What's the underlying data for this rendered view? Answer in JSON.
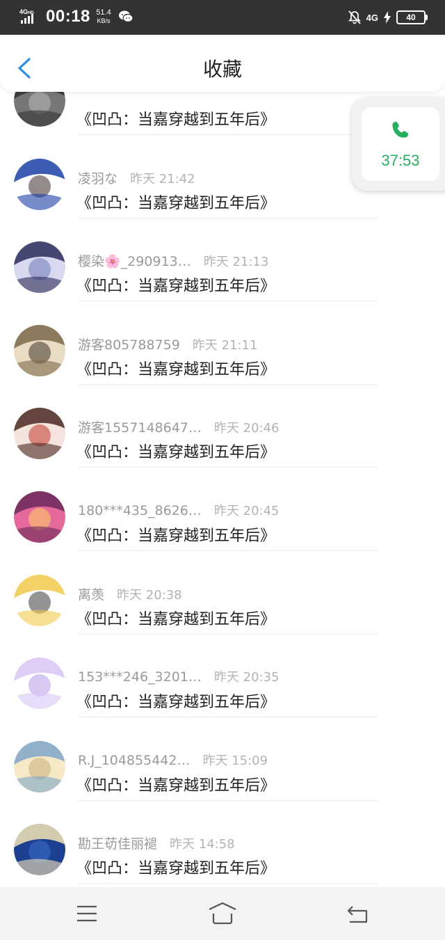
{
  "status": {
    "network": "4G HD",
    "time": "00:18",
    "speed_value": "51.4",
    "speed_unit": "KB/s",
    "network_right": "4G",
    "battery": "40"
  },
  "header": {
    "title": "收藏"
  },
  "call": {
    "duration": "37:53",
    "color": "#27ae60"
  },
  "items": [
    {
      "user": "",
      "time": "",
      "book": "《凹凸：当嘉穿越到五年后》",
      "colors": [
        "#333",
        "#777",
        "#bbb"
      ]
    },
    {
      "user": "凌羽な",
      "time": "昨天 21:42",
      "book": "《凹凸：当嘉穿越到五年后》",
      "colors": [
        "#1b3fa6",
        "#ffffff",
        "#3c2a2a"
      ]
    },
    {
      "user": "樱染🌸_290913…",
      "time": "昨天 21:13",
      "book": "《凹凸：当嘉穿越到五年后》",
      "colors": [
        "#2b2b5a",
        "#d7d9ee",
        "#6f78b8"
      ]
    },
    {
      "user": "游客805788759",
      "time": "昨天 21:11",
      "book": "《凹凸：当嘉穿越到五年后》",
      "colors": [
        "#7b6a4a",
        "#e8dcc5",
        "#3d3524"
      ]
    },
    {
      "user": "游客1557148647…",
      "time": "昨天 20:46",
      "book": "《凹凸：当嘉穿越到五年后》",
      "colors": [
        "#4a2a22",
        "#f5e3de",
        "#c0392b"
      ]
    },
    {
      "user": "180***435_8626…",
      "time": "昨天 20:45",
      "book": "《凹凸：当嘉穿越到五年后》",
      "colors": [
        "#6b2a5a",
        "#e56a9b",
        "#ffd166"
      ]
    },
    {
      "user": "离羡",
      "time": "昨天 20:38",
      "book": "《凹凸：当嘉穿越到五年后》",
      "colors": [
        "#f0c94a",
        "#ffffff",
        "#3a3a3a"
      ]
    },
    {
      "user": "153***246_3201…",
      "time": "昨天 20:35",
      "book": "《凹凸：当嘉穿越到五年后》",
      "colors": [
        "#d8c6f4",
        "#ffffff",
        "#b69ae6"
      ]
    },
    {
      "user": "R.J_104855442…",
      "time": "昨天 15:09",
      "book": "《凹凸：当嘉穿越到五年后》",
      "colors": [
        "#7fa6c9",
        "#f6e9c6",
        "#c7b07a"
      ]
    },
    {
      "user": "勘王苆佳丽褪",
      "time": "昨天 14:58",
      "book": "《凹凸：当嘉穿越到五年后》",
      "colors": [
        "#f6e4b5",
        "#1d3f8f",
        "#3b6fd1"
      ]
    }
  ],
  "nav": [
    "menu-icon",
    "home-icon",
    "back-icon"
  ]
}
